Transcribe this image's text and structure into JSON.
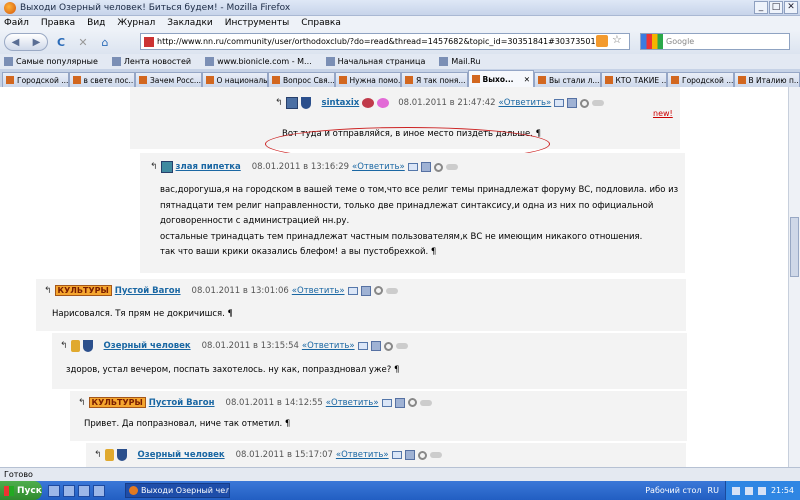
{
  "window": {
    "title": "Выходи Озерный человек! Биться будем! - Mozilla Firefox",
    "buttons": [
      "_",
      "□",
      "✕"
    ]
  },
  "menu": [
    "Файл",
    "Правка",
    "Вид",
    "Журнал",
    "Закладки",
    "Инструменты",
    "Справка"
  ],
  "nav": {
    "back": "◀",
    "forward": "▶",
    "reload": "C",
    "stop": "✕",
    "home": "⌂",
    "url": "http://www.nn.ru/community/user/orthodoxclub/?do=read&thread=1457682&topic_id=30351841#30373501",
    "search_placeholder": "Google",
    "star": "☆"
  },
  "bookmarks": [
    "Самые популярные",
    "Лента новостей",
    "www.bionicle.com - M...",
    "Начальная страница",
    "Mail.Ru"
  ],
  "tabs": [
    {
      "label": "Городской ..."
    },
    {
      "label": "в свете пос..."
    },
    {
      "label": "Зачем Росс..."
    },
    {
      "label": "О националь..."
    },
    {
      "label": "Вопрос Свя..."
    },
    {
      "label": "Нужна помо..."
    },
    {
      "label": "Я так поня..."
    },
    {
      "label": "Выхо...",
      "active": true
    },
    {
      "label": "Вы стали л..."
    },
    {
      "label": "КТО ТАКИЕ ..."
    },
    {
      "label": "Городской ..."
    },
    {
      "label": "В Италию п..."
    }
  ],
  "posts": [
    {
      "user": "sintaxix",
      "date": "08.01.2011 в 21:47:42",
      "reply": "«Ответить»",
      "text": [
        "Вот туда и отправляйся, в иное место пиздеть дальше. ¶"
      ],
      "new": "new!"
    },
    {
      "user": "злая пипетка",
      "date": "08.01.2011 в 13:16:29",
      "reply": "«Ответить»",
      "text": [
        "вас,дорогуша,я на городском в вашей теме о том,что все религ темы принадлежат форуму ВС, подловила. ибо из",
        "пятнадцати тем религ направленности, только две принадлежат синтаксису,и одна из них по официальной",
        "договоренности с администрацией нн.ру.",
        "остальные тринадцать тем принадлежат частным пользователям,к ВС не имеющим никакого отношения.",
        "так что ваши крики оказались блефом! а вы пустобрехкой. ¶"
      ]
    },
    {
      "user": "Пустой Вагон",
      "tag": "КУЛЬТУРЫ",
      "date": "08.01.2011 в 13:01:06",
      "reply": "«Ответить»",
      "text": [
        "Нарисовался. Тя прям не докричишся. ¶"
      ]
    },
    {
      "user": "Озерный человек",
      "date": "08.01.2011 в 13:15:54",
      "reply": "«Ответить»",
      "text": [
        "здоров, устал вечером, поспать захотелось. ну как, попраздновал уже? ¶"
      ]
    },
    {
      "user": "Пустой Вагон",
      "tag": "КУЛЬТУРЫ",
      "date": "08.01.2011 в 14:12:55",
      "reply": "«Ответить»",
      "text": [
        "Привет. Да попразновал, ниче так отметил. ¶"
      ]
    },
    {
      "user": "Озерный человек",
      "date": "08.01.2011 в 15:17:07",
      "reply": "«Ответить»",
      "text": []
    }
  ],
  "status": "Готово",
  "taskbar": {
    "start": "Пуск",
    "item": "Выходи Озерный чел...",
    "desktop": "Рабочий стол",
    "lang": "RU",
    "time": "21:54"
  }
}
